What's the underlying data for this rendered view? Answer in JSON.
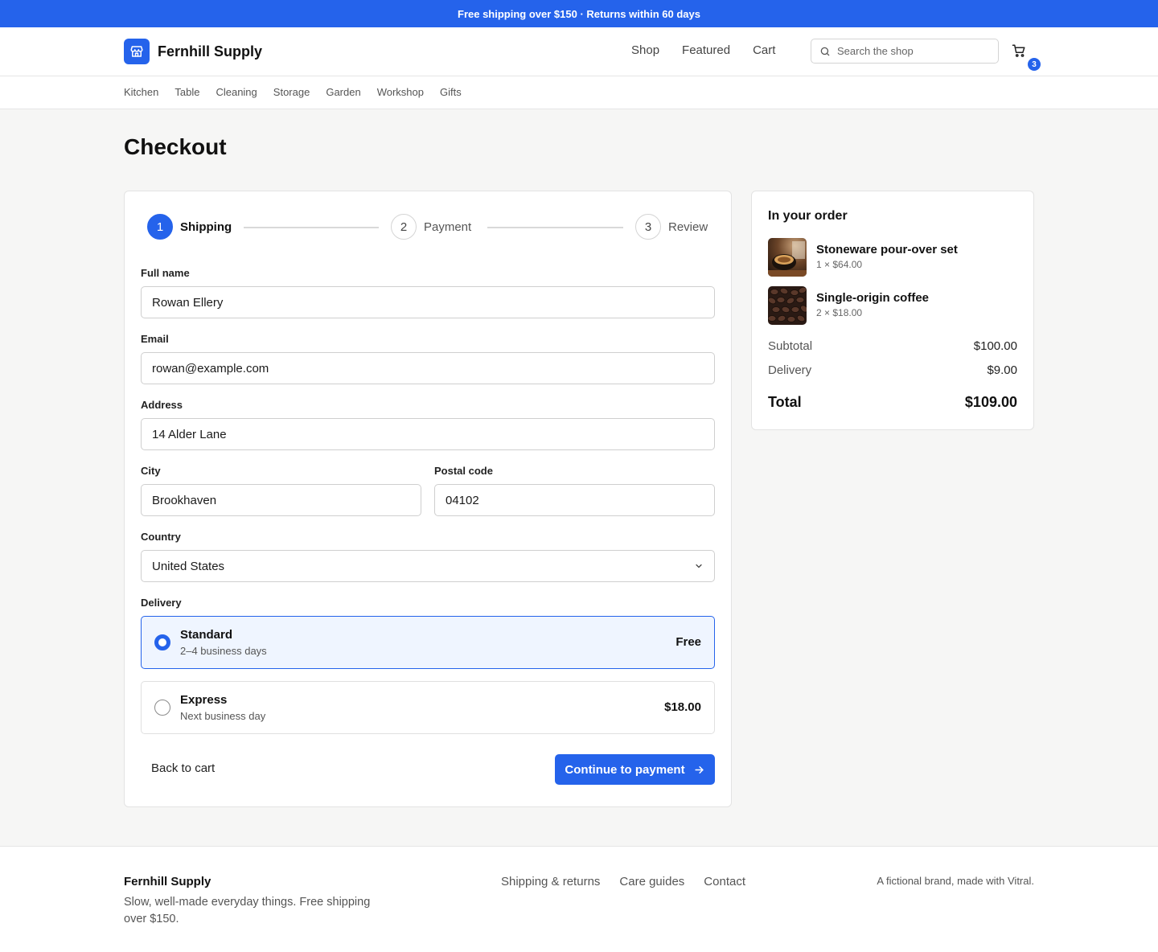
{
  "promo": {
    "text": "Free shipping over $150 · Returns within 60 days"
  },
  "header": {
    "brand": "Fernhill Supply",
    "nav": [
      "Shop",
      "Featured",
      "Cart"
    ],
    "search_placeholder": "Search the shop",
    "cart_count": "3"
  },
  "categories": [
    "Kitchen",
    "Table",
    "Cleaning",
    "Storage",
    "Garden",
    "Workshop",
    "Gifts"
  ],
  "page": {
    "title": "Checkout"
  },
  "stepper": {
    "steps": [
      {
        "num": "1",
        "label": "Shipping",
        "active": true
      },
      {
        "num": "2",
        "label": "Payment",
        "active": false
      },
      {
        "num": "3",
        "label": "Review",
        "active": false
      }
    ]
  },
  "form": {
    "full_name": {
      "label": "Full name",
      "value": "Rowan Ellery"
    },
    "email": {
      "label": "Email",
      "value": "rowan@example.com"
    },
    "address": {
      "label": "Address",
      "value": "14 Alder Lane"
    },
    "city": {
      "label": "City",
      "value": "Brookhaven"
    },
    "postal": {
      "label": "Postal code",
      "value": "04102"
    },
    "country": {
      "label": "Country",
      "value": "United States"
    },
    "delivery": {
      "label": "Delivery",
      "options": [
        {
          "title": "Standard",
          "subtitle": "2–4 business days",
          "price": "Free",
          "selected": true
        },
        {
          "title": "Express",
          "subtitle": "Next business day",
          "price": "$18.00",
          "selected": false
        }
      ]
    },
    "back_label": "Back to cart",
    "continue_label": "Continue to payment"
  },
  "summary": {
    "title": "In your order",
    "items": [
      {
        "name": "Stoneware pour-over set",
        "meta": "1 × $64.00"
      },
      {
        "name": "Single-origin coffee",
        "meta": "2 × $18.00"
      }
    ],
    "subtotal_label": "Subtotal",
    "subtotal": "$100.00",
    "delivery_label": "Delivery",
    "delivery": "$9.00",
    "total_label": "Total",
    "total": "$109.00"
  },
  "footer": {
    "brand": "Fernhill Supply",
    "tagline": "Slow, well-made everyday things. Free shipping over $150.",
    "links": [
      "Shipping & returns",
      "Care guides",
      "Contact"
    ],
    "note": "A fictional brand, made with Vitral."
  },
  "colors": {
    "accent": "#2563eb",
    "background": "#f6f6f5"
  }
}
